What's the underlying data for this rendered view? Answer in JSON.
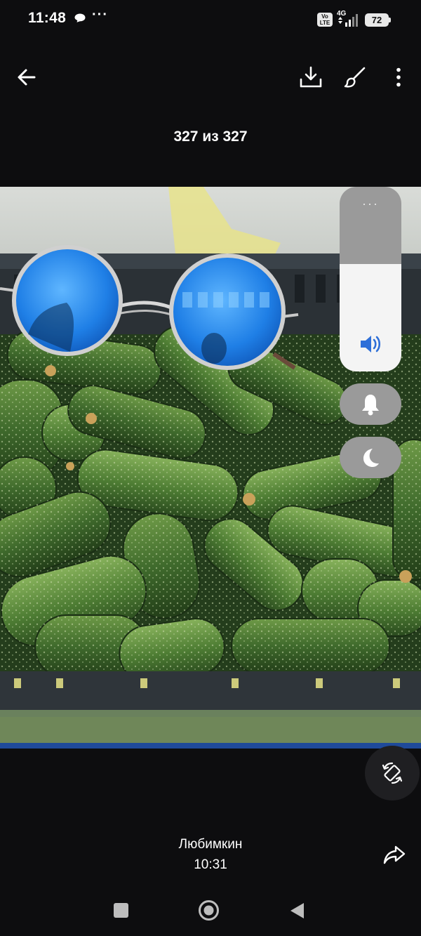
{
  "status_bar": {
    "time": "11:48",
    "volte_top": "Vo",
    "volte_bottom": "LTE",
    "network": "4G",
    "battery": "72",
    "more": "···"
  },
  "toolbar": {
    "back_icon": "arrow-left-icon",
    "download_icon": "download-icon",
    "edit_icon": "brush-icon",
    "more_icon": "more-vertical-icon"
  },
  "counter": "327 из 327",
  "photo": {
    "subject": "photo",
    "colors": {
      "cucumber_dark": "#2f4a26",
      "cucumber_light": "#5f8a3d",
      "crate": "#2b3136",
      "lens": "#1f7fe6"
    }
  },
  "volume_panel": {
    "level": 0.58,
    "menu_icon": "···",
    "speaker_icon": "volume-icon",
    "bell_icon": "bell-icon",
    "moon_icon": "moon-icon",
    "accent": "#2e6fd8"
  },
  "rotate_icon": "rotate-screen-icon",
  "message": {
    "sender": "Любимкин",
    "time": "10:31",
    "share_icon": "share-icon"
  },
  "nav": {
    "recents_icon": "square-icon",
    "home_icon": "circle-icon",
    "back_icon": "triangle-back-icon"
  }
}
